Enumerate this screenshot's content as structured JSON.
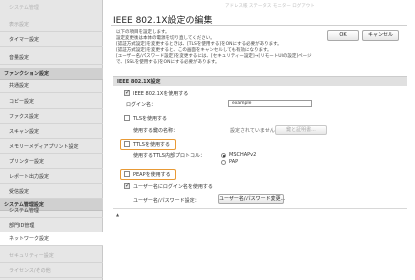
{
  "topbar": {
    "faded_text": "アドレス帳 ステータス モニター ログアウト"
  },
  "sidebar": {
    "top_faded": "システム管理",
    "items": [
      {
        "label": "表示設定",
        "state": "faded"
      },
      {
        "label": "タイマー設定",
        "state": "normal"
      },
      {
        "label": "音量設定",
        "state": "normal"
      }
    ],
    "header_function": "ファンクション設定",
    "function_items": [
      "共通設定",
      "コピー設定",
      "ファクス設定",
      "スキャン設定",
      "メモリーメディアプリント設定",
      "プリンター設定",
      "レポート出力設定",
      "受信設定"
    ],
    "header_system": "システム管理設定",
    "system_items": [
      {
        "label": "システム管理",
        "state": "normal"
      },
      {
        "label": "部門ID管理",
        "state": "normal"
      },
      {
        "label": "ネットワーク設定",
        "state": "active"
      },
      {
        "label": "セキュリティー設定",
        "state": "faded"
      },
      {
        "label": "ライセンス/その他",
        "state": "faded"
      }
    ]
  },
  "page": {
    "title": "IEEE 802.1X設定の編集",
    "ok_label": "OK",
    "cancel_label": "キャンセル",
    "notes": [
      "以下の項目を設定します。",
      "設定変更後は本体の電源を切り直してください。",
      "[認証方式設定]を変更するときは、[TLSを使用する]をONにする必要があります。",
      "[認証方式設定]を変更すると、この画面をキャンセルしても有効になります。",
      "[ユーザー名/パスワード設定]を変更するには、[セキュリティー設定]→[リモートUIの設定]ページ",
      "で、[SSLを使用する]をONにする必要があります。"
    ],
    "section_label": "IEEE 802.1X設定",
    "use_ieee": {
      "label": "IEEE 802.1Xを使用する",
      "checked": true
    },
    "login_name": {
      "label": "ログイン名：",
      "value": "example"
    },
    "use_tls": {
      "label": "TLSを使用する",
      "checked": false
    },
    "key_name": {
      "label": "使用する鍵の名称：",
      "status": "設定されていません。",
      "button_label": "鍵と証明書..."
    },
    "use_ttls": {
      "label": "TTLSを使用する",
      "checked": false
    },
    "ttls_protocol": {
      "label": "使用するTTLS内部プロトコル：",
      "options": [
        {
          "label": "MSCHAPv2",
          "selected": true
        },
        {
          "label": "PAP",
          "selected": false
        }
      ]
    },
    "use_peap": {
      "label": "PEAPを使用する",
      "checked": false
    },
    "use_login_as_user": {
      "label": "ユーザー名にログイン名を使用する",
      "checked": true
    },
    "user_password": {
      "label": "ユーザー名/パスワード設定：",
      "button_label": "ユーザー名/パスワード変更..."
    },
    "footer_marker": "▲"
  },
  "colors": {
    "highlight": "#e89a36",
    "sidebar_bg": "#e6e6e6",
    "section_bg": "#e0e0e0"
  }
}
